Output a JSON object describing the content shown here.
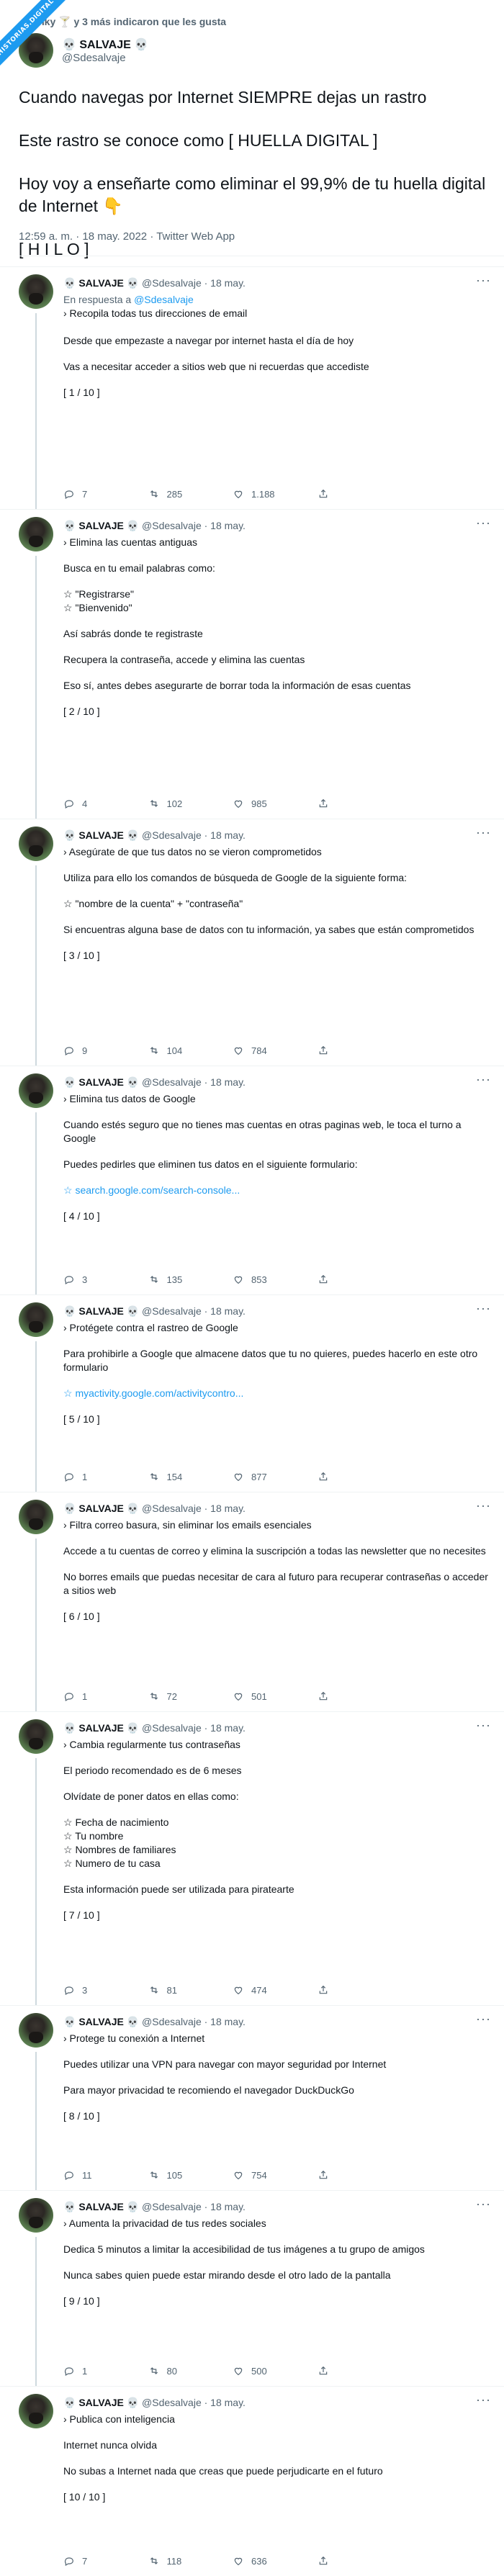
{
  "ribbon": "HISTORIAS.DIGITAL",
  "liked_by": "Panky 🍸 y 3 más indicaron que les gusta",
  "author": {
    "name": "💀 SALVAJE 💀",
    "handle": "@Sdesalvaje"
  },
  "main_tweet": {
    "paragraphs": [
      "Cuando navegas por Internet SIEMPRE dejas un rastro",
      "Este rastro se conoce como [ HUELLA DIGITAL ]",
      "Hoy voy a enseñarte como eliminar el 99,9% de tu huella digital de Internet 👇",
      "[ H I L O ]"
    ],
    "meta": "12:59 a. m. · 18 may. 2022 · Twitter Web App"
  },
  "reply_to_label": "En respuesta a",
  "reply_date": "· 18 may.",
  "replies": [
    {
      "show_reply_to": true,
      "paragraphs": [
        "› Recopila todas tus direcciones de email\n\nDesde que empezaste a navegar por internet hasta el día de hoy",
        "Vas a necesitar acceder a sitios web que ni recuerdas que accediste",
        "[ 1 / 10 ]"
      ],
      "link": "",
      "stats": {
        "replies": "7",
        "retweets": "285",
        "likes": "1.188"
      }
    },
    {
      "show_reply_to": false,
      "paragraphs": [
        "› Elimina las cuentas antiguas",
        "Busca en tu email palabras como:",
        "☆ \"Registrarse\"\n☆ \"Bienvenido\"",
        "Así sabrás donde te registraste",
        "Recupera la contraseña, accede y elimina las cuentas",
        "Eso sí, antes debes asegurarte de borrar toda la información de esas cuentas",
        "[ 2 / 10 ]"
      ],
      "link": "",
      "stats": {
        "replies": "4",
        "retweets": "102",
        "likes": "985"
      }
    },
    {
      "show_reply_to": false,
      "paragraphs": [
        "› Asegúrate de que tus datos no se vieron comprometidos",
        "Utiliza para ello los comandos de búsqueda de Google de la siguiente forma:",
        "☆ \"nombre de la cuenta\" + \"contraseña\"",
        "Si encuentras alguna base de datos con tu información, ya sabes que están comprometidos",
        "[ 3 / 10 ]"
      ],
      "link": "",
      "stats": {
        "replies": "9",
        "retweets": "104",
        "likes": "784"
      }
    },
    {
      "show_reply_to": false,
      "paragraphs": [
        "› Elimina tus datos de Google",
        "Cuando estés seguro que no tienes mas cuentas en otras paginas web, le toca el turno a Google",
        "Puedes pedirles que eliminen tus datos en el siguiente formulario:"
      ],
      "link": "☆ search.google.com/search-console...",
      "tail": "[ 4 / 10 ]",
      "stats": {
        "replies": "3",
        "retweets": "135",
        "likes": "853"
      }
    },
    {
      "show_reply_to": false,
      "paragraphs": [
        "› Protégete contra el rastreo de Google",
        "Para prohibirle a Google que almacene datos que tu no quieres, puedes hacerlo en este otro formulario"
      ],
      "link": "☆ myactivity.google.com/activitycontro...",
      "tail": "[ 5 / 10 ]",
      "stats": {
        "replies": "1",
        "retweets": "154",
        "likes": "877"
      }
    },
    {
      "show_reply_to": false,
      "paragraphs": [
        "› Filtra correo basura, sin eliminar los emails esenciales",
        "Accede a tu cuentas de correo y elimina la suscripción a todas las newsletter que no necesites",
        "No borres emails que puedas necesitar de cara al futuro para recuperar contraseñas o acceder a sitios web",
        "[ 6 / 10 ]"
      ],
      "link": "",
      "stats": {
        "replies": "1",
        "retweets": "72",
        "likes": "501"
      }
    },
    {
      "show_reply_to": false,
      "paragraphs": [
        "› Cambia regularmente tus contraseñas",
        "El periodo recomendado es de 6 meses",
        "Olvídate de poner datos en ellas como:",
        "☆ Fecha de nacimiento\n☆ Tu nombre\n☆ Nombres de familiares\n☆ Numero de tu casa",
        "Esta información puede ser utilizada para piratearte",
        "[ 7 / 10 ]"
      ],
      "link": "",
      "stats": {
        "replies": "3",
        "retweets": "81",
        "likes": "474"
      }
    },
    {
      "show_reply_to": false,
      "paragraphs": [
        "› Protege tu conexión a Internet",
        "Puedes utilizar una VPN para navegar con mayor seguridad por Internet",
        "Para mayor privacidad te recomiendo el navegador DuckDuckGo",
        "[ 8 / 10 ]"
      ],
      "link": "",
      "stats": {
        "replies": "11",
        "retweets": "105",
        "likes": "754"
      }
    },
    {
      "show_reply_to": false,
      "paragraphs": [
        "› Aumenta la privacidad de tus redes sociales",
        "Dedica 5 minutos a limitar la accesibilidad de tus imágenes a tu grupo de amigos",
        "Nunca sabes quien puede estar mirando desde el otro lado de la pantalla",
        "[ 9 / 10 ]"
      ],
      "link": "",
      "stats": {
        "replies": "1",
        "retweets": "80",
        "likes": "500"
      }
    },
    {
      "show_reply_to": false,
      "paragraphs": [
        "› Publica con inteligencia",
        "Internet nunca olvida",
        "No subas a Internet nada que creas que puede perjudicarte en el futuro",
        "[ 10 / 10 ]"
      ],
      "link": "",
      "stats": {
        "replies": "7",
        "retweets": "118",
        "likes": "636"
      }
    }
  ]
}
